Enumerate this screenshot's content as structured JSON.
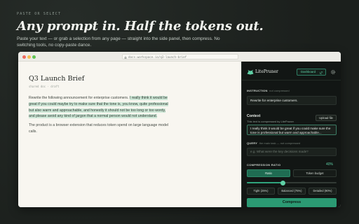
{
  "hero": {
    "eyebrow": "PASTE OR SELECT",
    "title": "Any prompt in. Half the tokens out.",
    "subtitle": "Paste your text — or grab a selection from any page — straight into the side panel, then compress. No switching tools, no copy-paste dance."
  },
  "browser": {
    "url": "docs.workspace.io/q3-launch-brief"
  },
  "document": {
    "title": "Q3 Launch Brief",
    "meta": "shared doc · draft",
    "paragraph1_plain": "Rewrite the following announcement for enterprise customers. ",
    "paragraph1_highlight": "I really think it would be great if you could maybe try to make sure that the tone is, you know, quite professional but also warm and approachable, and honestly it should not be too long or too wordy, and please avoid any kind of jargon that a normal person would not understand.",
    "paragraph2": "The product is a browser extension that reduces token spend on large language model calls."
  },
  "panel": {
    "brand": "LitePruner",
    "dashboard_label": "Dashboard",
    "instruction_label": "INSTRUCTION",
    "instruction_note": "not compressed",
    "instruction_value": "Rewrite for enterprise customers.",
    "context_label": "Context",
    "context_note": "This text is compressed by LitePruner",
    "upload_label": "Upload file",
    "context_value": "I really think it would be great if you could make sure the tone is professional but warm and approachable...",
    "query_label": "QUERY",
    "query_note": "the main task — not compressed",
    "query_placeholder": "e.g. What were the key decisions made?",
    "ratio_label": "COMPRESSION RATIO",
    "ratio_value": "40%",
    "ratio_fraction": 0.4,
    "mode_ratio": "Ratio",
    "mode_budget": "Token budget",
    "preset_tight": "Tight (25%)",
    "preset_balanced": "Balanced (75%)",
    "preset_detailed": "Detailed (90%)",
    "compress_label": "Compress"
  },
  "colors": {
    "accent": "#2b9a73",
    "accent_light": "#5fd0a6",
    "highlight": "#cfe8d8",
    "panel_bg": "#121614",
    "doc_bg": "#f8f6f0"
  }
}
